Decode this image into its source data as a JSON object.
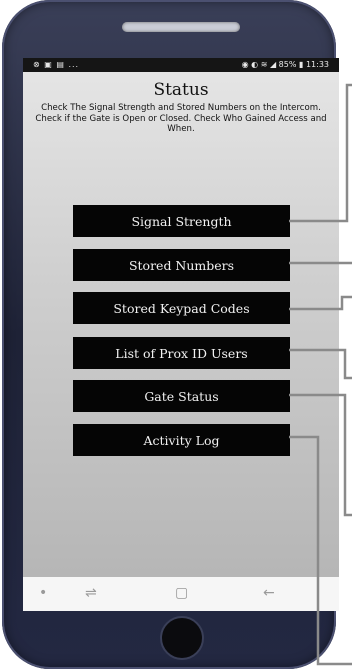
{
  "statusbar": {
    "left_text": "⊗ ▣ ▤ ...",
    "battery": "85%",
    "time": "11:33"
  },
  "page": {
    "title": "Status",
    "description": "Check The Signal Strength and Stored Numbers on the Intercom. Check if the Gate is Open or Closed. Check Who Gained Access and When."
  },
  "menu": [
    {
      "label": "Signal Strength"
    },
    {
      "label": "Stored Numbers"
    },
    {
      "label": "Stored Keypad Codes"
    },
    {
      "label": "List of Prox ID Users"
    },
    {
      "label": "Gate Status"
    },
    {
      "label": "Activity Log"
    }
  ],
  "navbar": {
    "dot_icon": "•",
    "recent_icon": "⇌",
    "home_icon": "▢",
    "back_icon": "←"
  },
  "colors": {
    "button_bg": "#050505",
    "callout_line": "#8a8a8a"
  }
}
